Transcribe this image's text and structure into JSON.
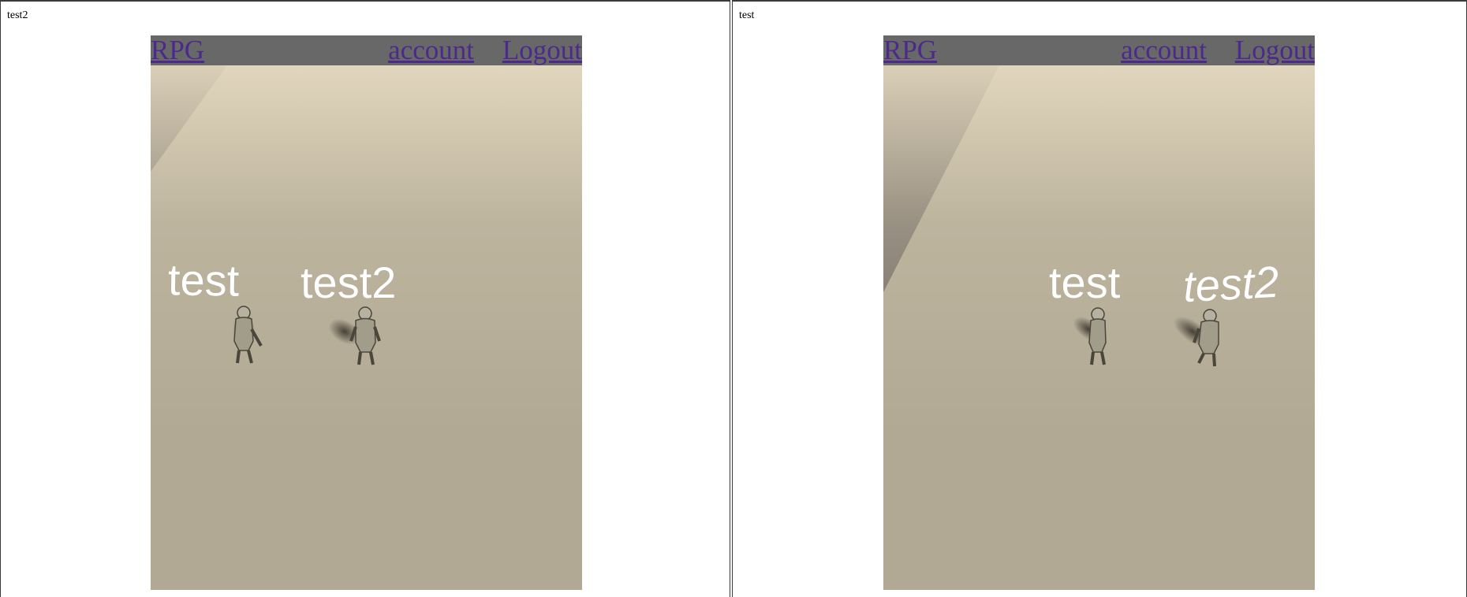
{
  "windows": [
    {
      "label": "test2",
      "nav": {
        "home": "RPG",
        "account": "account",
        "logout": "Logout"
      },
      "names": [
        "test",
        "test2"
      ]
    },
    {
      "label": "test",
      "nav": {
        "home": "RPG",
        "account": "account",
        "logout": "Logout"
      },
      "names": [
        "test",
        "test2"
      ]
    }
  ],
  "colors": {
    "topbar": "#686868",
    "floor": "#b2a994",
    "wall": "#6a625d",
    "link": "#4b2a8b"
  }
}
